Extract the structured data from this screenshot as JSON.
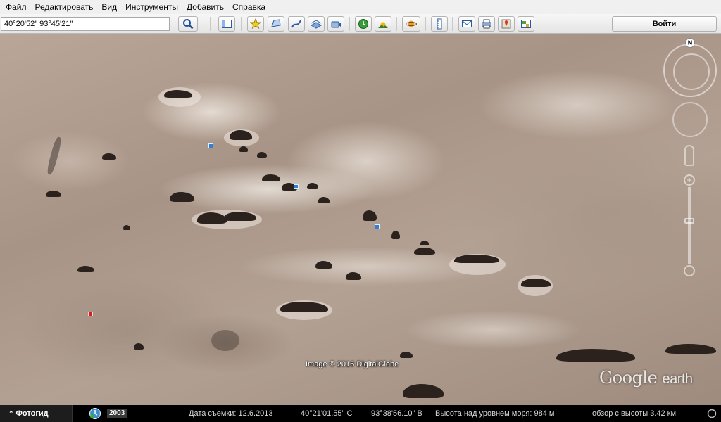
{
  "menu": [
    "Файл",
    "Редактировать",
    "Вид",
    "Инструменты",
    "Добавить",
    "Справка"
  ],
  "search": {
    "value": "40°20'52\" 93°45'21\""
  },
  "toolbar": {
    "signin_label": "Войти"
  },
  "map": {
    "image_credit": "Image © 2016 DigitalGlobe",
    "logo_google": "Google",
    "logo_earth": "earth",
    "compass_letter": "N",
    "zoom_plus": "+",
    "zoom_minus": "–"
  },
  "status": {
    "tour_label": "Фотогид",
    "year": "2003",
    "imagery_date": "Дата съемки: 12.6.2013",
    "lat": "40°21'01.55\" С",
    "lon": "93°38'56.10\" В",
    "elevation": "Высота над уровнем моря:   984 м",
    "eye_alt": "обзор с высоты   3.42 км"
  },
  "colors": {
    "statusbar": "#000000",
    "toolbar": "#e8e8e8",
    "terrain": "#b0a090"
  }
}
